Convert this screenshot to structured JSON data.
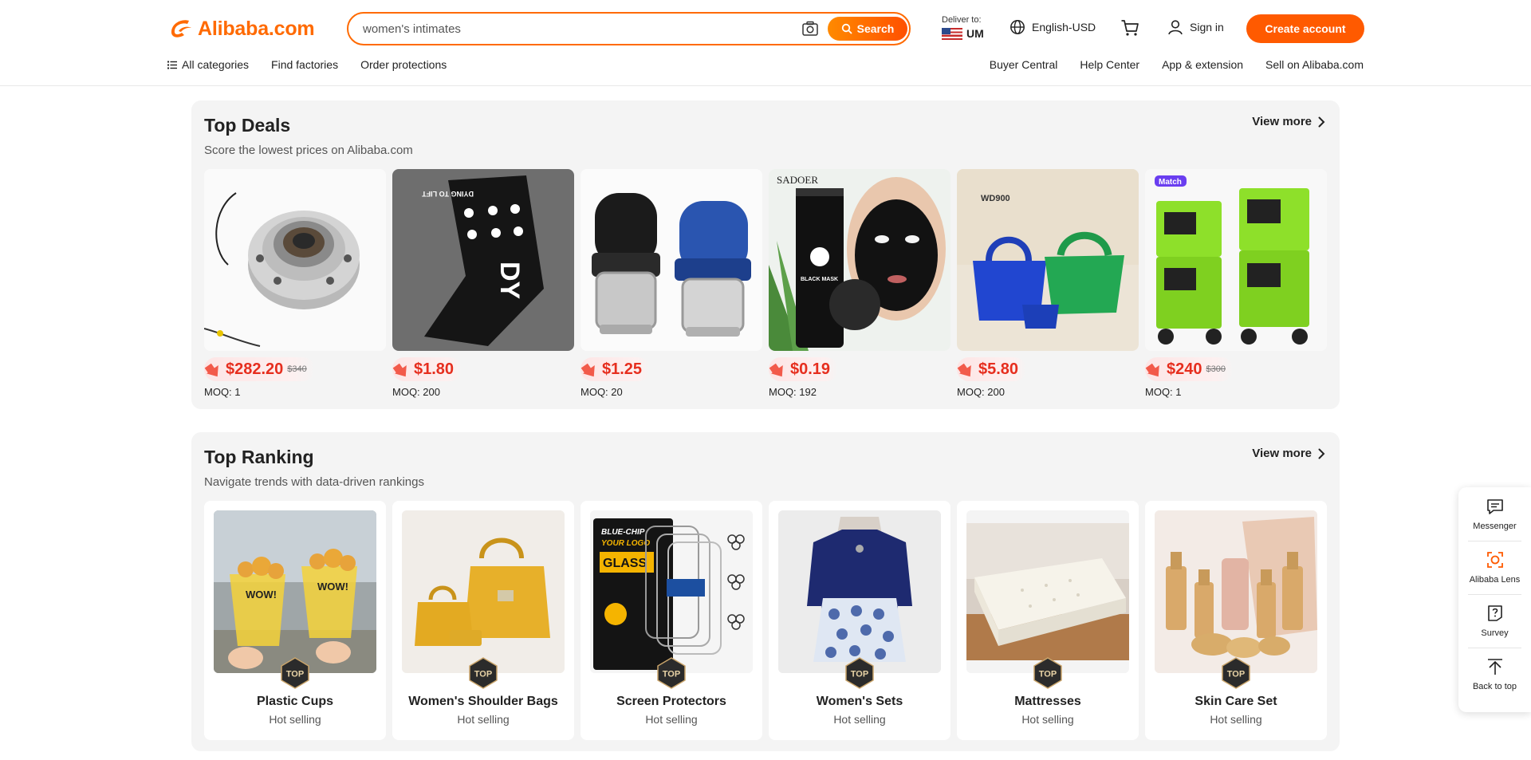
{
  "brand": {
    "name": "Alibaba.com",
    "accent": "#ff6a00"
  },
  "search": {
    "value": "women's intimates",
    "button_label": "Search"
  },
  "header": {
    "deliver_to_label": "Deliver to:",
    "deliver_to_code": "UM",
    "language": "English-USD",
    "signin_label": "Sign in",
    "create_account_label": "Create account"
  },
  "subnav": {
    "left": [
      "All categories",
      "Find factories",
      "Order protections"
    ],
    "right": [
      "Buyer Central",
      "Help Center",
      "App & extension",
      "Sell on Alibaba.com"
    ]
  },
  "top_deals": {
    "title": "Top Deals",
    "subtitle": "Score the lowest prices on Alibaba.com",
    "view_more": "View more",
    "items": [
      {
        "image_icon": "wheel-hub-icon",
        "price": "$282.20",
        "old_price": "$340",
        "moq": "MOQ: 1"
      },
      {
        "image_icon": "fabric-label-icon",
        "image_text": "DYING TO LIFT",
        "price": "$1.80",
        "old_price": "",
        "moq": "MOQ: 200"
      },
      {
        "image_icon": "stamp-icon",
        "price": "$1.25",
        "old_price": "",
        "moq": "MOQ: 20"
      },
      {
        "image_icon": "face-mask-icon",
        "image_text": "SADOER",
        "image_text_2": "BLACK MASK",
        "price": "$0.19",
        "old_price": "",
        "moq": "MOQ: 192"
      },
      {
        "image_icon": "handbag-icon",
        "image_text": "WD900",
        "price": "$5.80",
        "old_price": "",
        "moq": "MOQ: 200"
      },
      {
        "image_icon": "welder-icon",
        "image_text": "Match",
        "price": "$240",
        "old_price": "$300",
        "moq": "MOQ: 1"
      }
    ]
  },
  "top_ranking": {
    "title": "Top Ranking",
    "subtitle": "Navigate trends with data-driven rankings",
    "view_more": "View more",
    "badge_label": "TOP",
    "items": [
      {
        "image_icon": "plastic-cups-icon",
        "image_text": "WOW!",
        "name": "Plastic Cups",
        "tag": "Hot selling"
      },
      {
        "image_icon": "shoulder-bag-icon",
        "name": "Women's Shoulder Bags",
        "tag": "Hot selling"
      },
      {
        "image_icon": "screen-protector-icon",
        "image_text": "BLUE-CHIP",
        "image_text_2": "YOUR LOGO",
        "image_text_3": "GLASS",
        "name": "Screen Protectors",
        "tag": "Hot selling"
      },
      {
        "image_icon": "womens-set-icon",
        "name": "Women's Sets",
        "tag": "Hot selling"
      },
      {
        "image_icon": "mattress-icon",
        "name": "Mattresses",
        "tag": "Hot selling"
      },
      {
        "image_icon": "skin-care-set-icon",
        "name": "Skin Care Set",
        "tag": "Hot selling"
      }
    ]
  },
  "float_toolbar": [
    "Messenger",
    "Alibaba Lens",
    "Survey",
    "Back to top"
  ]
}
